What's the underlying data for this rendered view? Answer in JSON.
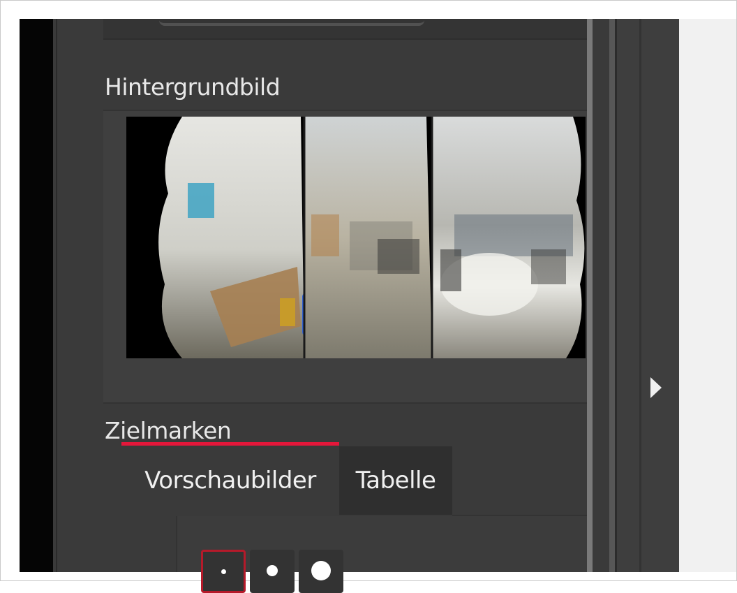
{
  "panel": {
    "background_section": {
      "title": "Hintergrundbild"
    },
    "targets_section": {
      "title": "Zielmarken",
      "tabs": [
        {
          "label": "Vorschaubilder",
          "active": true
        },
        {
          "label": "Tabelle",
          "active": false
        }
      ],
      "marker_sizes": [
        "small",
        "medium",
        "large"
      ],
      "selected_marker": "small"
    }
  },
  "colors": {
    "panel_bg": "#3a3a3a",
    "accent": "#e4173a",
    "selected_border": "#b51a2a",
    "text": "#e8e8e8"
  },
  "icons": {
    "collapse": "chevron-right-icon"
  }
}
